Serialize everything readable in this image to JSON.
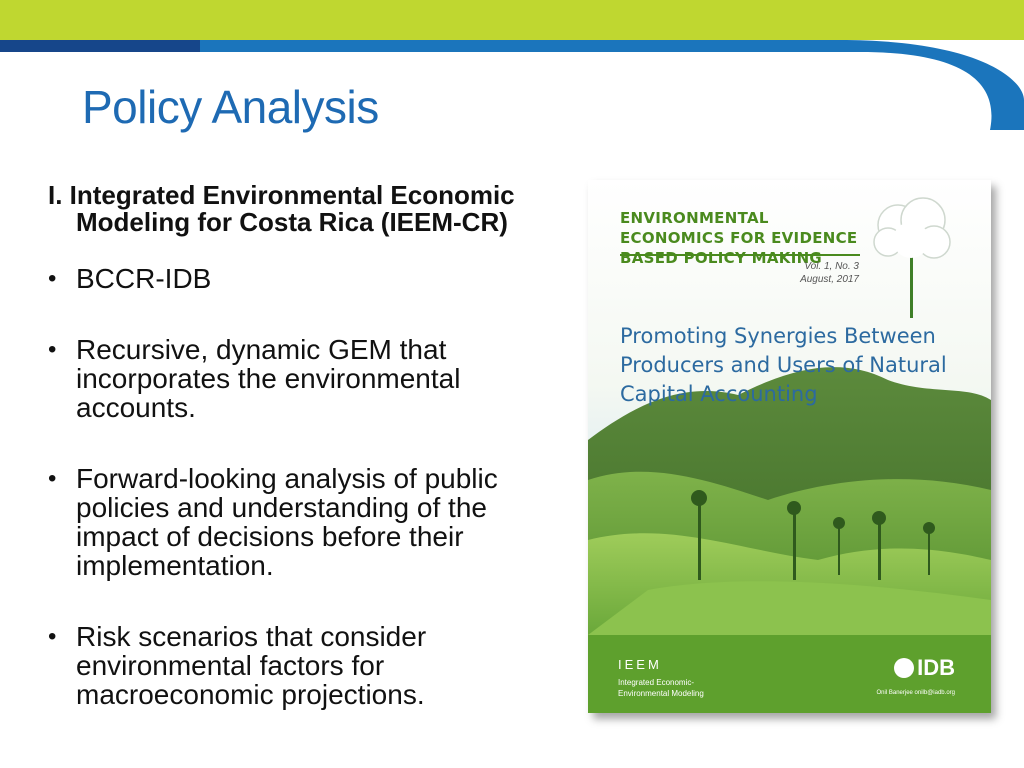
{
  "slide": {
    "title": "Policy Analysis",
    "section_heading": "I. Integrated Environmental Economic Modeling for Costa Rica (IEEM-CR)",
    "bullets": [
      {
        "text": "BCCR-IDB"
      },
      {
        "text": "Recursive, dynamic GEM that incorporates the environmental accounts."
      },
      {
        "text": "Forward-looking analysis of public policies and understanding of the impact of decisions before their implementation."
      },
      {
        "text": "Risk scenarios that consider environmental factors for macroeconomic projections."
      }
    ],
    "bullet_glyph": "•"
  },
  "cover": {
    "series": "ENVIRONMENTAL ECONOMICS FOR EVIDENCE BASED POLICY MAKING",
    "issue": "Vol. 1, No. 3",
    "date": "August, 2017",
    "headline": "Promoting Synergies Between Producers and Users of Natural Capital Accounting",
    "brand": "IEEM",
    "brand_sub_1": "Integrated Economic-",
    "brand_sub_2": "Environmental Modeling",
    "idb": "IDB",
    "credit": "Onil Banerjee onilb@iadb.org"
  },
  "colors": {
    "title": "#1e6ab3",
    "lime": "#bfd730",
    "blue_band": "#1b75bc",
    "cover_green": "#5ea02d"
  }
}
